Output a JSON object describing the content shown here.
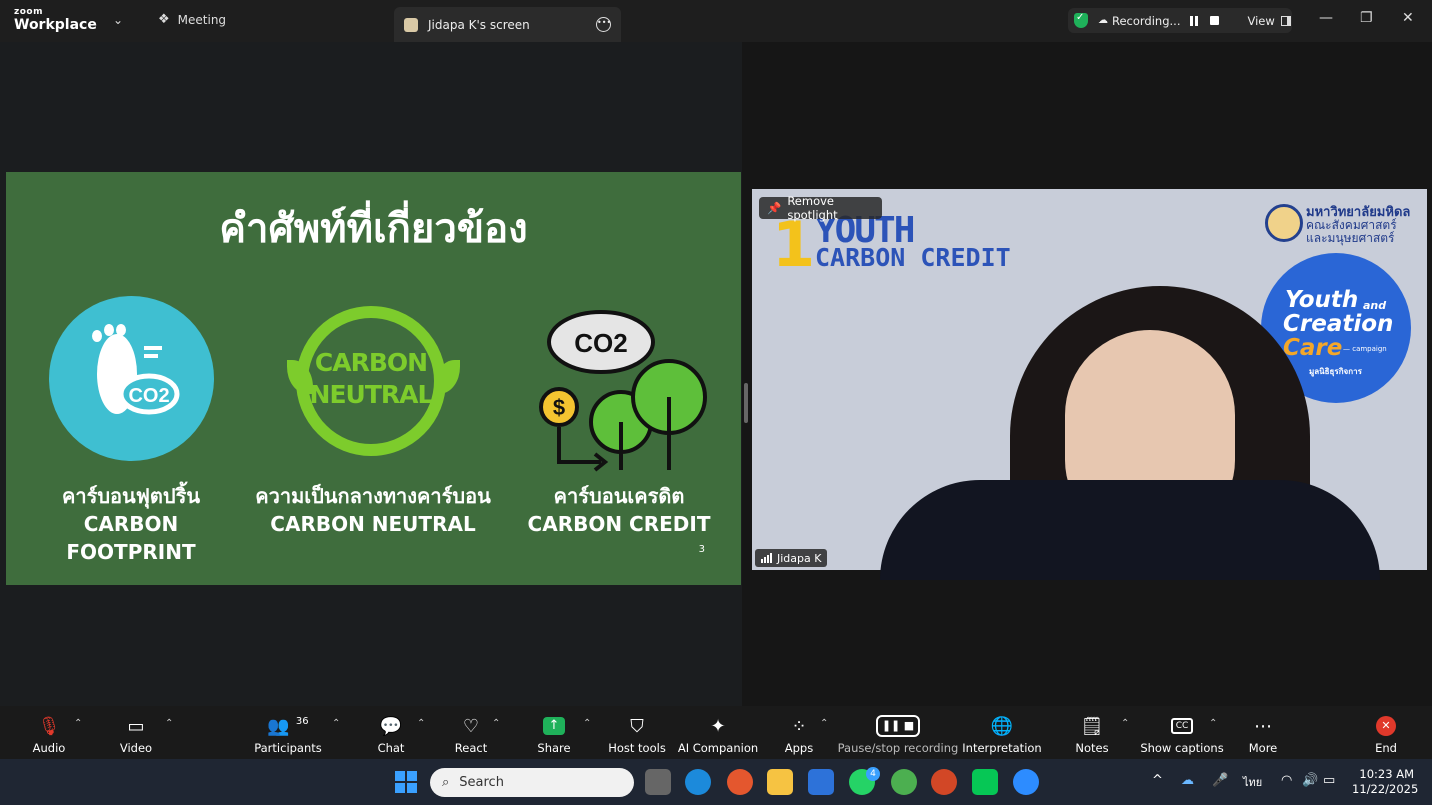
{
  "app": {
    "brand_top": "zoom",
    "brand_bottom": "Workplace"
  },
  "tabs": {
    "meeting": "Meeting",
    "screen": "Jidapa K's screen"
  },
  "recording": {
    "status": "Recording...",
    "view": "View"
  },
  "slide": {
    "title": "คำศัพท์ที่เกี่ยวข้อง",
    "page": "3",
    "items": [
      {
        "thai": "คาร์บอนฟุตปริ้น",
        "en": "CARBON FOOTPRINT"
      },
      {
        "thai": "ความเป็นกลางทางคาร์บอน",
        "en": "CARBON NEUTRAL"
      },
      {
        "thai": "คาร์บอนเครดิต",
        "en": "CARBON CREDIT"
      }
    ],
    "icon_texts": {
      "co2_foot": "CO2",
      "neutral_1": "CARBON",
      "neutral_2": "NEUTRAL",
      "cloud": "CO2",
      "dollar": "$"
    }
  },
  "video": {
    "spotlight_label": "Remove spotlight",
    "participant_name": "Jidapa K",
    "bg_number": "1",
    "bg_line1": "YOUTH",
    "bg_line2": "CARBON CREDIT",
    "org_line1": "มหาวิทยาลัยมหิดล",
    "org_line2": "คณะสังคมศาสตร์",
    "org_line3": "และมนุษยศาสตร์",
    "badge_youth": "Youth",
    "badge_and": "and",
    "badge_creation": "Creation",
    "badge_care": "Care",
    "badge_campaign": "— campaign",
    "badge_sub": "มูลนิธิธุรกิจการ"
  },
  "toolbar": {
    "audio": "Audio",
    "video": "Video",
    "participants": "Participants",
    "participants_count": "36",
    "chat": "Chat",
    "react": "React",
    "share": "Share",
    "host_tools": "Host tools",
    "ai_companion": "AI Companion",
    "apps": "Apps",
    "pause_stop": "Pause/stop recording",
    "interpretation": "Interpretation",
    "notes": "Notes",
    "captions": "Show captions",
    "more": "More",
    "end": "End"
  },
  "taskbar": {
    "search_placeholder": "Search",
    "whatsapp_badge": "4",
    "lang": "ไทย",
    "time": "10:23 AM",
    "date": "11/22/2025"
  },
  "colors": {
    "slide_bg": "#3f6d3d",
    "neutral_green": "#7dcc2c",
    "foot_teal": "#3fbfd1",
    "badge_blue": "#2a66d6",
    "end_red": "#e0392b",
    "share_green": "#1fb15a"
  }
}
